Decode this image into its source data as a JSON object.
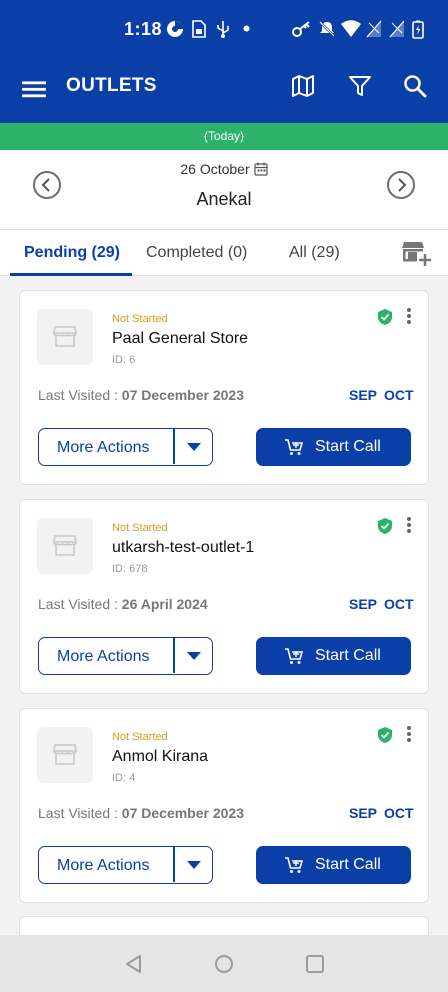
{
  "status_bar": {
    "time": "1:18",
    "icons": [
      "data-saver-icon",
      "sim-card-icon",
      "usb-icon",
      "dot-icon",
      "key-icon",
      "mute-icon",
      "wifi-icon",
      "signal-icon",
      "signal-icon",
      "battery-icon"
    ]
  },
  "app_bar": {
    "title": "OUTLETS",
    "icons": [
      "menu-icon",
      "map-icon",
      "filter-icon",
      "search-icon"
    ]
  },
  "today_strip": "(Today)",
  "date_bar": {
    "date": "26 October",
    "area": "Anekal"
  },
  "tabs": [
    {
      "label": "Pending (29)",
      "active": true
    },
    {
      "label": "Completed (0)",
      "active": false
    },
    {
      "label": "All (29)",
      "active": false
    }
  ],
  "outlets": [
    {
      "status": "Not Started",
      "name": "Paal General Store",
      "id": "ID: 6",
      "last_visited_label": "Last Visited :",
      "last_visited_date": "07 December 2023",
      "months": [
        "SEP",
        "OCT"
      ],
      "more_actions": "More Actions",
      "start_call": "Start Call"
    },
    {
      "status": "Not Started",
      "name": "utkarsh-test-outlet-1",
      "id": "ID: 678",
      "last_visited_label": "Last Visited :",
      "last_visited_date": "26 April 2024",
      "months": [
        "SEP",
        "OCT"
      ],
      "more_actions": "More Actions",
      "start_call": "Start Call"
    },
    {
      "status": "Not Started",
      "name": "Anmol Kirana",
      "id": "ID: 4",
      "last_visited_label": "Last Visited :",
      "last_visited_date": "07 December 2023",
      "months": [
        "SEP",
        "OCT"
      ],
      "more_actions": "More Actions",
      "start_call": "Start Call"
    }
  ],
  "colors": {
    "primary": "#0b3fa8",
    "today_green": "#2bb36a",
    "status_orange": "#d99a1a",
    "verified_green": "#2bb36a"
  }
}
